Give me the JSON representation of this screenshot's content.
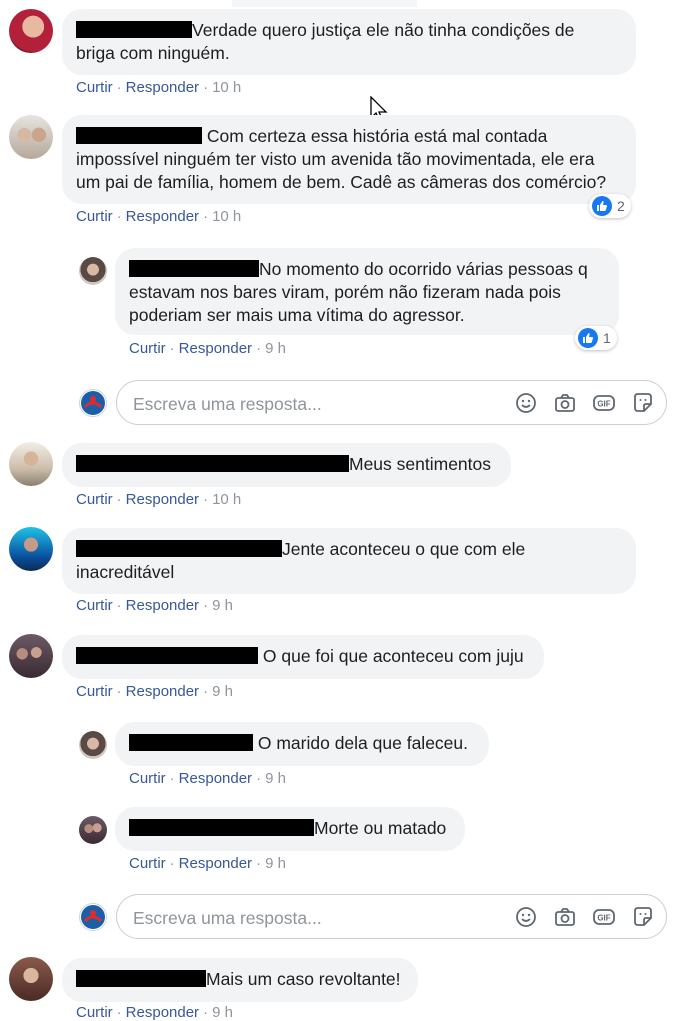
{
  "comments": [
    {
      "text": "Verdade quero justiça ele não tinha condições de briga com ninguém.",
      "actions": {
        "like": "Curtir",
        "reply": "Responder",
        "time": "10 h"
      }
    },
    {
      "text": "Com certeza essa história está mal contada impossível ninguém ter visto um avenida tão movimentada, ele era um pai de família, homem de bem. Cadê as câmeras dos comércio?",
      "line1": "Com certeza essa história está mal contada",
      "line2": "impossível ninguém ter visto um avenida tão movimentada, ele era",
      "line3": "um pai de família, homem de bem. Cadê as câmeras dos comércio?",
      "reactions": "2",
      "actions": {
        "like": "Curtir",
        "reply": "Responder",
        "time": "10 h"
      },
      "replies": [
        {
          "line1": "No momento do ocorrido várias pessoas q",
          "line2": "estavam nos bares viram, porém não fizeram nada pois",
          "line3": "poderiam ser mais uma vítima do agressor.",
          "reactions": "1",
          "actions": {
            "like": "Curtir",
            "reply": "Responder",
            "time": "9 h"
          }
        }
      ],
      "reply_placeholder": "Escreva uma resposta..."
    },
    {
      "text": "Meus sentimentos",
      "actions": {
        "like": "Curtir",
        "reply": "Responder",
        "time": "10 h"
      }
    },
    {
      "line1": "Jente aconteceu o que com ele",
      "line2": "inacreditável",
      "actions": {
        "like": "Curtir",
        "reply": "Responder",
        "time": "9 h"
      }
    },
    {
      "text": "O que foi que aconteceu com juju",
      "actions": {
        "like": "Curtir",
        "reply": "Responder",
        "time": "9 h"
      },
      "replies": [
        {
          "text": "O marido dela que faleceu.",
          "actions": {
            "like": "Curtir",
            "reply": "Responder",
            "time": "9 h"
          }
        },
        {
          "text": "Morte ou matado",
          "actions": {
            "like": "Curtir",
            "reply": "Responder",
            "time": "9 h"
          }
        }
      ],
      "reply_placeholder": "Escreva uma resposta..."
    },
    {
      "text": "Mais um caso revoltante!",
      "actions": {
        "like": "Curtir",
        "reply": "Responder",
        "time": "9 h"
      }
    }
  ],
  "c1_line1": "Verdade quero justiça ele não tinha condições de",
  "c1_line2": "briga com ninguém.",
  "gif_label": "GIF",
  "colors": {
    "link": "#385898",
    "bubble": "#f2f3f5",
    "like_blue": "#1877f2",
    "meta": "#90949c"
  },
  "icons": [
    "emoji-icon",
    "camera-icon",
    "gif-icon",
    "sticker-icon",
    "like-icon",
    "cursor-icon"
  ]
}
